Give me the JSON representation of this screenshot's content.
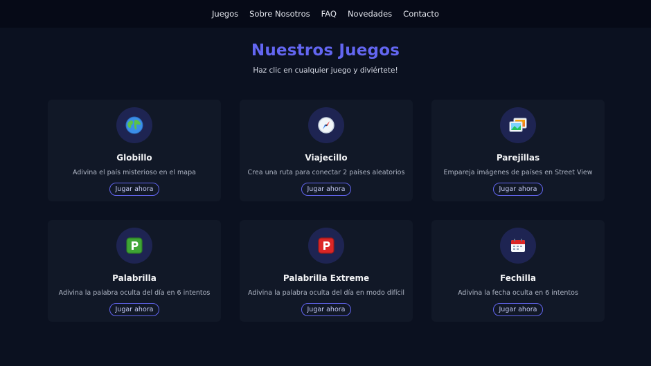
{
  "nav": {
    "items": [
      "Juegos",
      "Sobre Nosotros",
      "FAQ",
      "Novedades",
      "Contacto"
    ]
  },
  "header": {
    "title": "Nuestros Juegos",
    "subtitle": "Haz clic en cualquier juego y diviértete!"
  },
  "colors": {
    "accent": "#6366f1",
    "background": "#0b1120",
    "card": "#111827"
  },
  "games": [
    {
      "title": "Globillo",
      "desc": "Adivina el país misterioso en el mapa",
      "button": "Jugar ahora",
      "icon": "globe-icon"
    },
    {
      "title": "Viajecillo",
      "desc": "Crea una ruta para conectar 2 países aleatorios",
      "button": "Jugar ahora",
      "icon": "compass-icon"
    },
    {
      "title": "Parejillas",
      "desc": "Empareja imágenes de países en Street View",
      "button": "Jugar ahora",
      "icon": "pictures-icon"
    },
    {
      "title": "Palabrilla",
      "desc": "Adivina la palabra oculta del día en 6 intentos",
      "button": "Jugar ahora",
      "icon": "green-p-icon"
    },
    {
      "title": "Palabrilla Extreme",
      "desc": "Adivina la palabra oculta del día en modo difícil",
      "button": "Jugar ahora",
      "icon": "red-p-icon"
    },
    {
      "title": "Fechilla",
      "desc": "Adivina la fecha oculta en 6 intentos",
      "button": "Jugar ahora",
      "icon": "calendar-icon"
    }
  ]
}
